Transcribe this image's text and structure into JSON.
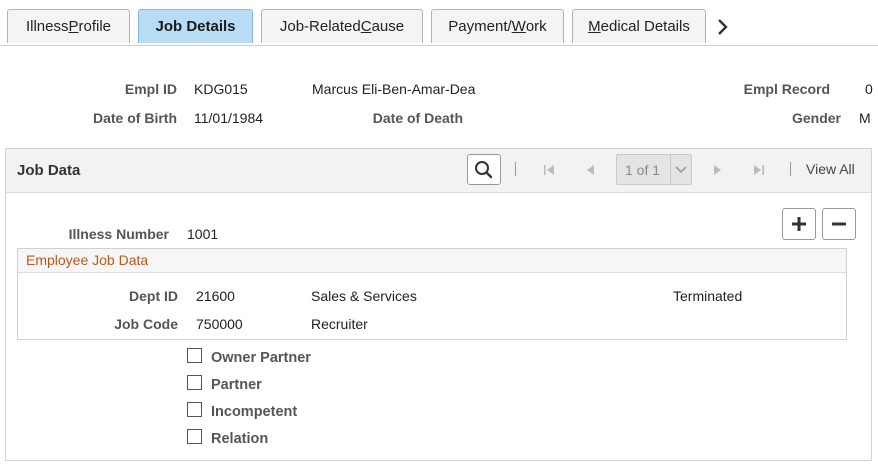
{
  "tabs": [
    {
      "pre": "Illness ",
      "u": "P",
      "post": "rofile"
    },
    {
      "pre": "Job Details",
      "u": "",
      "post": ""
    },
    {
      "pre": "Job-Related ",
      "u": "C",
      "post": "ause"
    },
    {
      "pre": "Payment/",
      "u": "W",
      "post": "ork"
    },
    {
      "pre": "",
      "u": "M",
      "post": "edical Details"
    }
  ],
  "header": {
    "empl_id_label": "Empl ID",
    "empl_id": "KDG015",
    "name": "Marcus Eli-Ben-Amar-Dea",
    "empl_record_label": "Empl Record",
    "empl_record": "0",
    "dob_label": "Date of Birth",
    "dob": "11/01/1984",
    "dod_label": "Date of Death",
    "gender_label": "Gender",
    "gender": "M"
  },
  "job_data": {
    "title": "Job Data",
    "pager": "1 of 1",
    "view_all": "View All",
    "illness_number_label": "Illness Number",
    "illness_number": "1001",
    "employee_job_data": {
      "title": "Employee Job Data",
      "dept_id_label": "Dept ID",
      "dept_id": "21600",
      "dept_name": "Sales & Services",
      "status": "Terminated",
      "job_code_label": "Job Code",
      "job_code": "750000",
      "job_title": "Recruiter"
    },
    "checkboxes": [
      "Owner Partner",
      "Partner",
      "Incompetent",
      "Relation"
    ]
  }
}
